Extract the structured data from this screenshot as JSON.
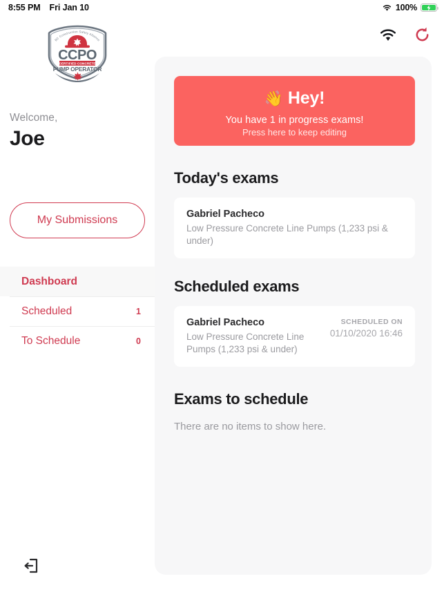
{
  "status_bar": {
    "time": "8:55 PM",
    "date": "Fri Jan 10",
    "battery_percent": "100%",
    "wifi_icon": "wifi-icon",
    "battery_icon": "battery-charging-icon"
  },
  "sidebar": {
    "logo_alt": "CCPO Certified Concrete Pump Operator",
    "logo_text": {
      "arc": "BC Construction Safety Alliance",
      "acronym": "CCPO",
      "banner": "CERTIFIED CONCRETE",
      "subtitle": "PUMP OPERATOR"
    },
    "welcome_label": "Welcome,",
    "user_name": "Joe",
    "submissions_button": "My Submissions",
    "nav_items": [
      {
        "label": "Dashboard",
        "count": "",
        "active": true
      },
      {
        "label": "Scheduled",
        "count": "1",
        "active": false
      },
      {
        "label": "To Schedule",
        "count": "0",
        "active": false
      }
    ],
    "logout_icon": "logout-icon"
  },
  "topbar": {
    "wifi_icon": "wifi-icon",
    "refresh_icon": "refresh-icon"
  },
  "banner": {
    "emoji": "👋",
    "title": "Hey!",
    "line1": "You have 1 in progress exams!",
    "line2": "Press here to keep editing",
    "color": "#fb6360"
  },
  "sections": {
    "today": {
      "title": "Today's exams",
      "items": [
        {
          "name": "Gabriel Pacheco",
          "subtitle": "Low Pressure Concrete Line Pumps (1,233 psi & under)"
        }
      ]
    },
    "scheduled": {
      "title": "Scheduled exams",
      "items": [
        {
          "name": "Gabriel Pacheco",
          "subtitle": "Low Pressure Concrete Line Pumps (1,233 psi & under)",
          "meta_label": "SCHEDULED ON",
          "meta_value": "01/10/2020 16:46"
        }
      ]
    },
    "to_schedule": {
      "title": "Exams to schedule",
      "empty_text": "There are no items to show here."
    }
  },
  "colors": {
    "accent_red": "#cf3a50",
    "banner_red": "#fb6360",
    "panel_bg": "#f7f7f8"
  }
}
